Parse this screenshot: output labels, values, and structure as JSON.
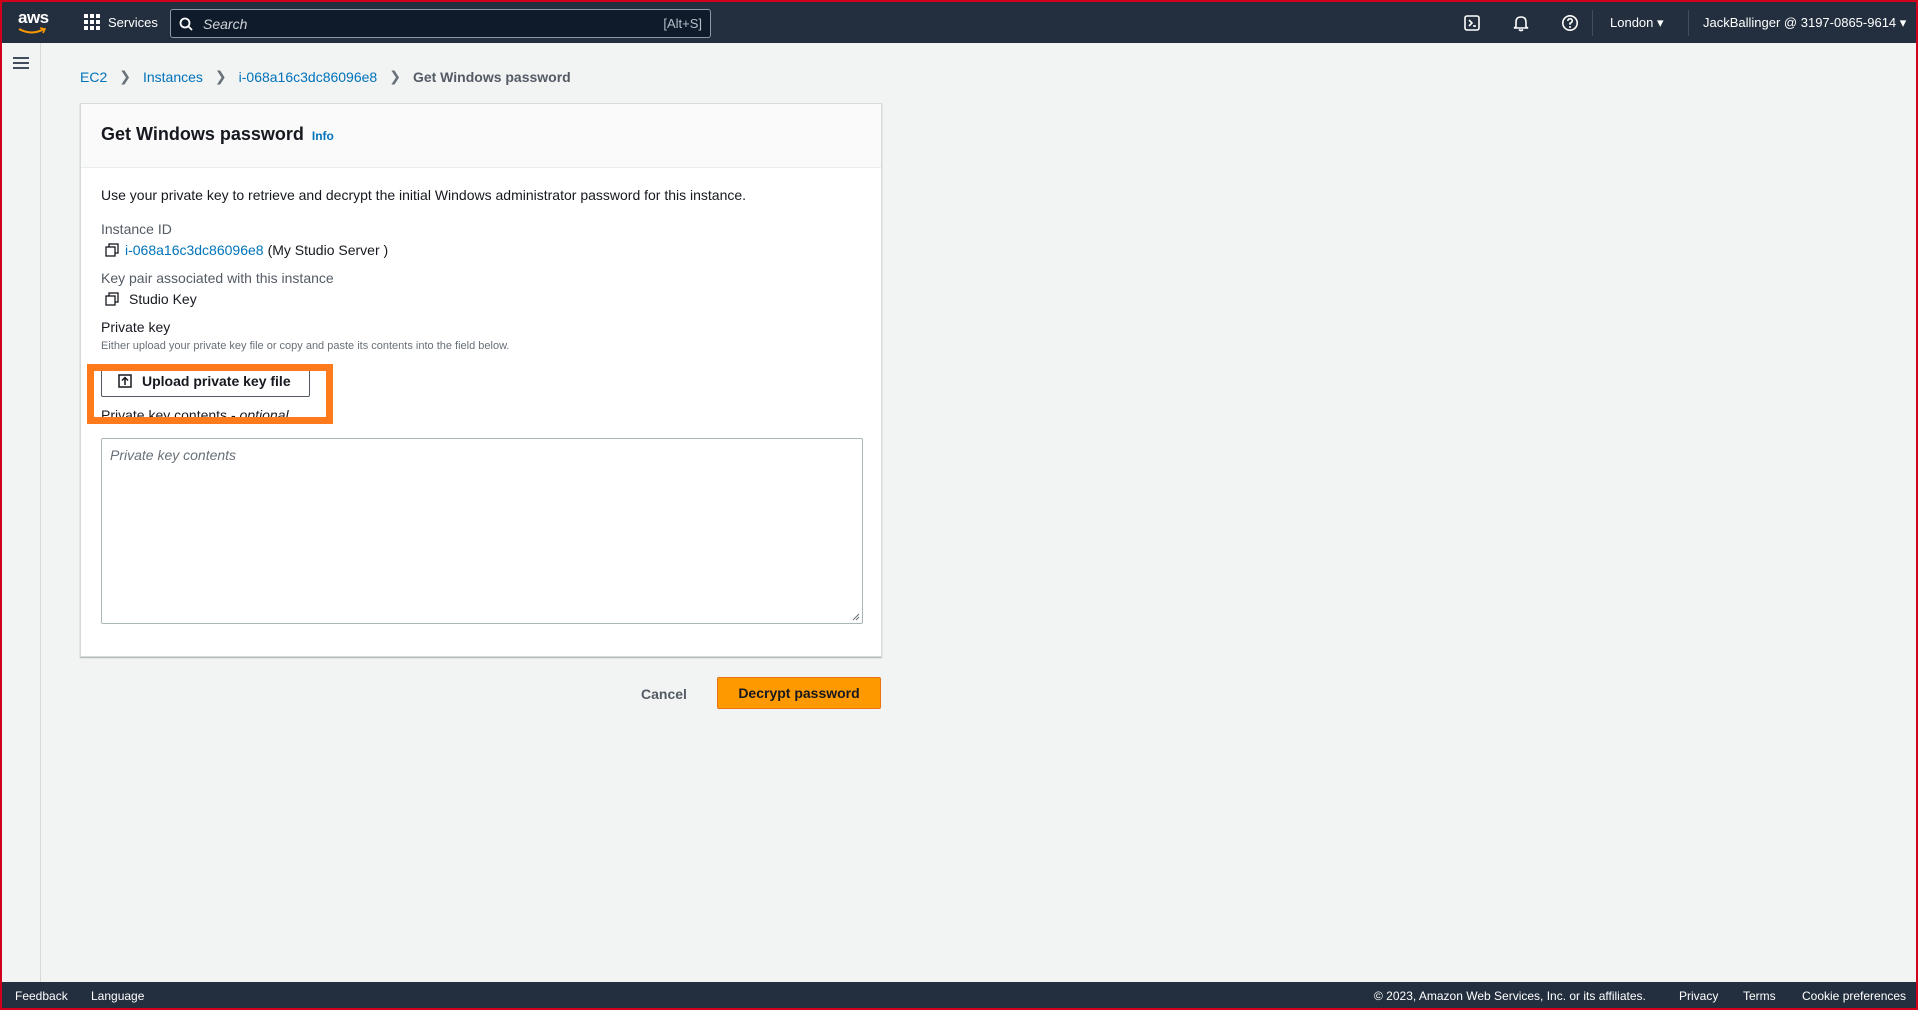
{
  "topnav": {
    "logo_text": "aws",
    "services_label": "Services",
    "search_placeholder": "Search",
    "search_hint": "[Alt+S]",
    "region": "London ▾",
    "account": "JackBallinger @ 3197-0865-9614 ▾"
  },
  "breadcrumb": {
    "items": [
      "EC2",
      "Instances",
      "i-068a16c3dc86096e8"
    ],
    "current": "Get Windows password"
  },
  "panel": {
    "title": "Get Windows password",
    "info": "Info",
    "description": "Use your private key to retrieve and decrypt the initial Windows administrator password for this instance.",
    "instance_id_label": "Instance ID",
    "instance_id": "i-068a16c3dc86096e8",
    "instance_name": "(My Studio Server )",
    "key_pair_label": "Key pair associated with this instance",
    "key_pair": "Studio Key",
    "private_key_label": "Private key",
    "private_key_help": "Either upload your private key file or copy and paste its contents into the field below.",
    "upload_button": "Upload private key file",
    "contents_label": "Private key contents - ",
    "contents_optional": "optional",
    "contents_placeholder": "Private key contents"
  },
  "actions": {
    "cancel": "Cancel",
    "decrypt": "Decrypt password"
  },
  "footer": {
    "feedback": "Feedback",
    "language": "Language",
    "copyright": "© 2023, Amazon Web Services, Inc. or its affiliates.",
    "privacy": "Privacy",
    "terms": "Terms",
    "cookie": "Cookie preferences"
  },
  "colors": {
    "nav": "#232f3e",
    "link": "#0073bb",
    "primary": "#ff9900",
    "highlight": "#ff7a1a"
  }
}
